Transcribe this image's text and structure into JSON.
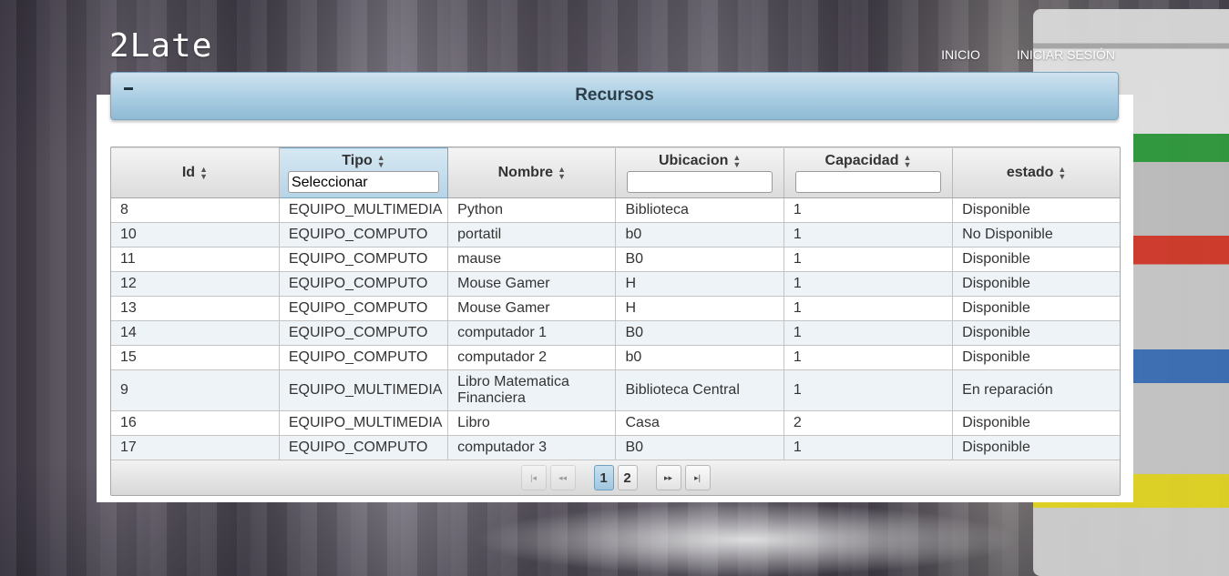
{
  "app": {
    "logo": "2Late"
  },
  "nav": {
    "home": "INICIO",
    "login": "INICIAR SESIÓN"
  },
  "panel": {
    "title": "Recursos"
  },
  "table": {
    "headers": {
      "id": "Id",
      "tipo": "Tipo",
      "nombre": "Nombre",
      "ubicacion": "Ubicacion",
      "capacidad": "Capacidad",
      "estado": "estado"
    },
    "filters": {
      "tipo_selected": "Seleccionar",
      "ubicacion_value": "",
      "capacidad_value": ""
    },
    "rows": [
      {
        "id": "8",
        "tipo": "EQUIPO_MULTIMEDIA",
        "nombre": "Python",
        "ubicacion": "Biblioteca",
        "capacidad": "1",
        "estado": "Disponible"
      },
      {
        "id": "10",
        "tipo": "EQUIPO_COMPUTO",
        "nombre": "portatil",
        "ubicacion": "b0",
        "capacidad": "1",
        "estado": "No Disponible"
      },
      {
        "id": "11",
        "tipo": "EQUIPO_COMPUTO",
        "nombre": "mause",
        "ubicacion": "B0",
        "capacidad": "1",
        "estado": "Disponible"
      },
      {
        "id": "12",
        "tipo": "EQUIPO_COMPUTO",
        "nombre": "Mouse Gamer",
        "ubicacion": "H",
        "capacidad": "1",
        "estado": "Disponible"
      },
      {
        "id": "13",
        "tipo": "EQUIPO_COMPUTO",
        "nombre": "Mouse Gamer",
        "ubicacion": "H",
        "capacidad": "1",
        "estado": "Disponible"
      },
      {
        "id": "14",
        "tipo": "EQUIPO_COMPUTO",
        "nombre": "computador 1",
        "ubicacion": "B0",
        "capacidad": "1",
        "estado": "Disponible"
      },
      {
        "id": "15",
        "tipo": "EQUIPO_COMPUTO",
        "nombre": "computador 2",
        "ubicacion": "b0",
        "capacidad": "1",
        "estado": "Disponible"
      },
      {
        "id": "9",
        "tipo": "EQUIPO_MULTIMEDIA",
        "nombre": "Libro Matematica Financiera",
        "ubicacion": "Biblioteca Central",
        "capacidad": "1",
        "estado": "En reparación"
      },
      {
        "id": "16",
        "tipo": "EQUIPO_MULTIMEDIA",
        "nombre": "Libro",
        "ubicacion": "Casa",
        "capacidad": "2",
        "estado": "Disponible"
      },
      {
        "id": "17",
        "tipo": "EQUIPO_COMPUTO",
        "nombre": "computador 3",
        "ubicacion": "B0",
        "capacidad": "1",
        "estado": "Disponible"
      }
    ]
  },
  "paginator": {
    "pages": [
      "1",
      "2"
    ],
    "current_page": "1"
  },
  "icons": {
    "sort": "sort-icon",
    "first": "first-page-icon",
    "prev": "prev-page-icon",
    "next": "next-page-icon",
    "last": "last-page-icon",
    "toggle": "minus-icon"
  }
}
